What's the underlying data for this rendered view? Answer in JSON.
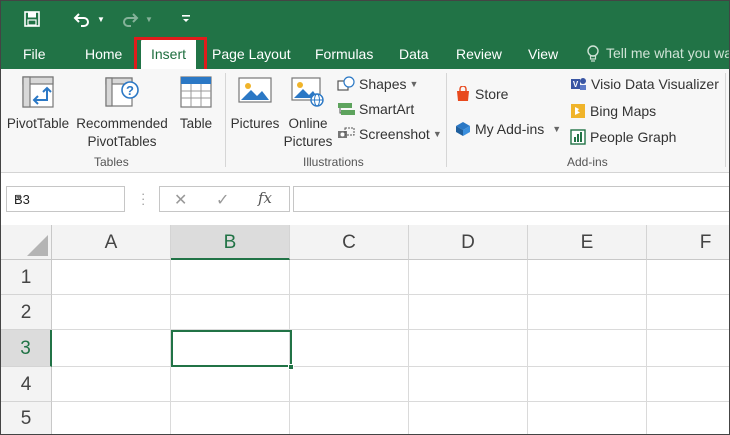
{
  "colors": {
    "accent": "#217346",
    "highlight_box": "#e01b1b"
  },
  "quick_access": {
    "save_icon": "save-icon",
    "undo_icon": "undo-icon",
    "redo_icon": "redo-icon",
    "customize_icon": "customize-toolbar-icon"
  },
  "tabs": [
    {
      "label": "File"
    },
    {
      "label": "Home"
    },
    {
      "label": "Insert",
      "active": true
    },
    {
      "label": "Page Layout"
    },
    {
      "label": "Formulas"
    },
    {
      "label": "Data"
    },
    {
      "label": "Review"
    },
    {
      "label": "View"
    }
  ],
  "tell_me": {
    "text": "Tell me what you wa",
    "icon": "lightbulb-icon"
  },
  "ribbon": {
    "groups": {
      "tables": {
        "label": "Tables",
        "pivottable": "PivotTable",
        "recommended_line1": "Recommended",
        "recommended_line2": "PivotTables",
        "table": "Table"
      },
      "illustrations": {
        "label": "Illustrations",
        "pictures": "Pictures",
        "online_line1": "Online",
        "online_line2": "Pictures",
        "shapes": "Shapes",
        "smartart": "SmartArt",
        "screenshot": "Screenshot"
      },
      "addins": {
        "label": "Add-ins",
        "store": "Store",
        "my_addins": "My Add-ins",
        "visio": "Visio Data Visualizer",
        "bing_maps": "Bing Maps",
        "people_graph": "People Graph"
      }
    }
  },
  "formula_bar": {
    "name_box": "B3",
    "cancel_symbol": "✕",
    "enter_symbol": "✓",
    "fx": "fx",
    "formula": ""
  },
  "sheet": {
    "columns": [
      "A",
      "B",
      "C",
      "D",
      "E",
      "F"
    ],
    "rows": [
      "1",
      "2",
      "3",
      "4",
      "5"
    ],
    "active_cell": "B3",
    "active_column": "B",
    "active_row": "3"
  }
}
